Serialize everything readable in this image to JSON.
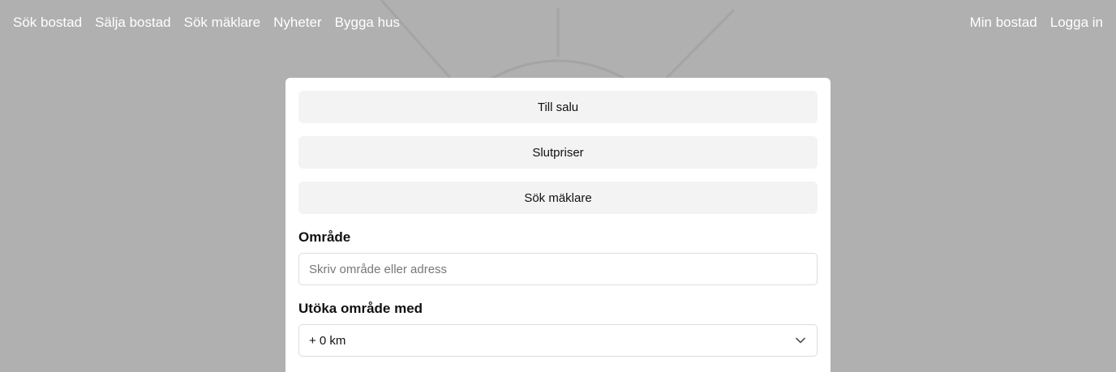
{
  "nav": {
    "left": [
      {
        "label": "Sök bostad"
      },
      {
        "label": "Sälja bostad"
      },
      {
        "label": "Sök mäklare"
      },
      {
        "label": "Nyheter"
      },
      {
        "label": "Bygga hus"
      }
    ],
    "right": [
      {
        "label": "Min bostad"
      },
      {
        "label": "Logga in"
      }
    ]
  },
  "search_card": {
    "modes": [
      {
        "label": "Till salu"
      },
      {
        "label": "Slutpriser"
      },
      {
        "label": "Sök mäklare"
      }
    ],
    "area": {
      "label": "Område",
      "placeholder": "Skriv område eller adress",
      "value": ""
    },
    "extend": {
      "label": "Utöka område med",
      "selected": "+ 0 km"
    }
  },
  "colors": {
    "background_overlay": "#b0b0b0",
    "card": "#ffffff",
    "mode_button": "#f3f3f3",
    "nav_text": "#ffffff"
  },
  "icons": {
    "select_indicator": "chevron-down-icon"
  }
}
